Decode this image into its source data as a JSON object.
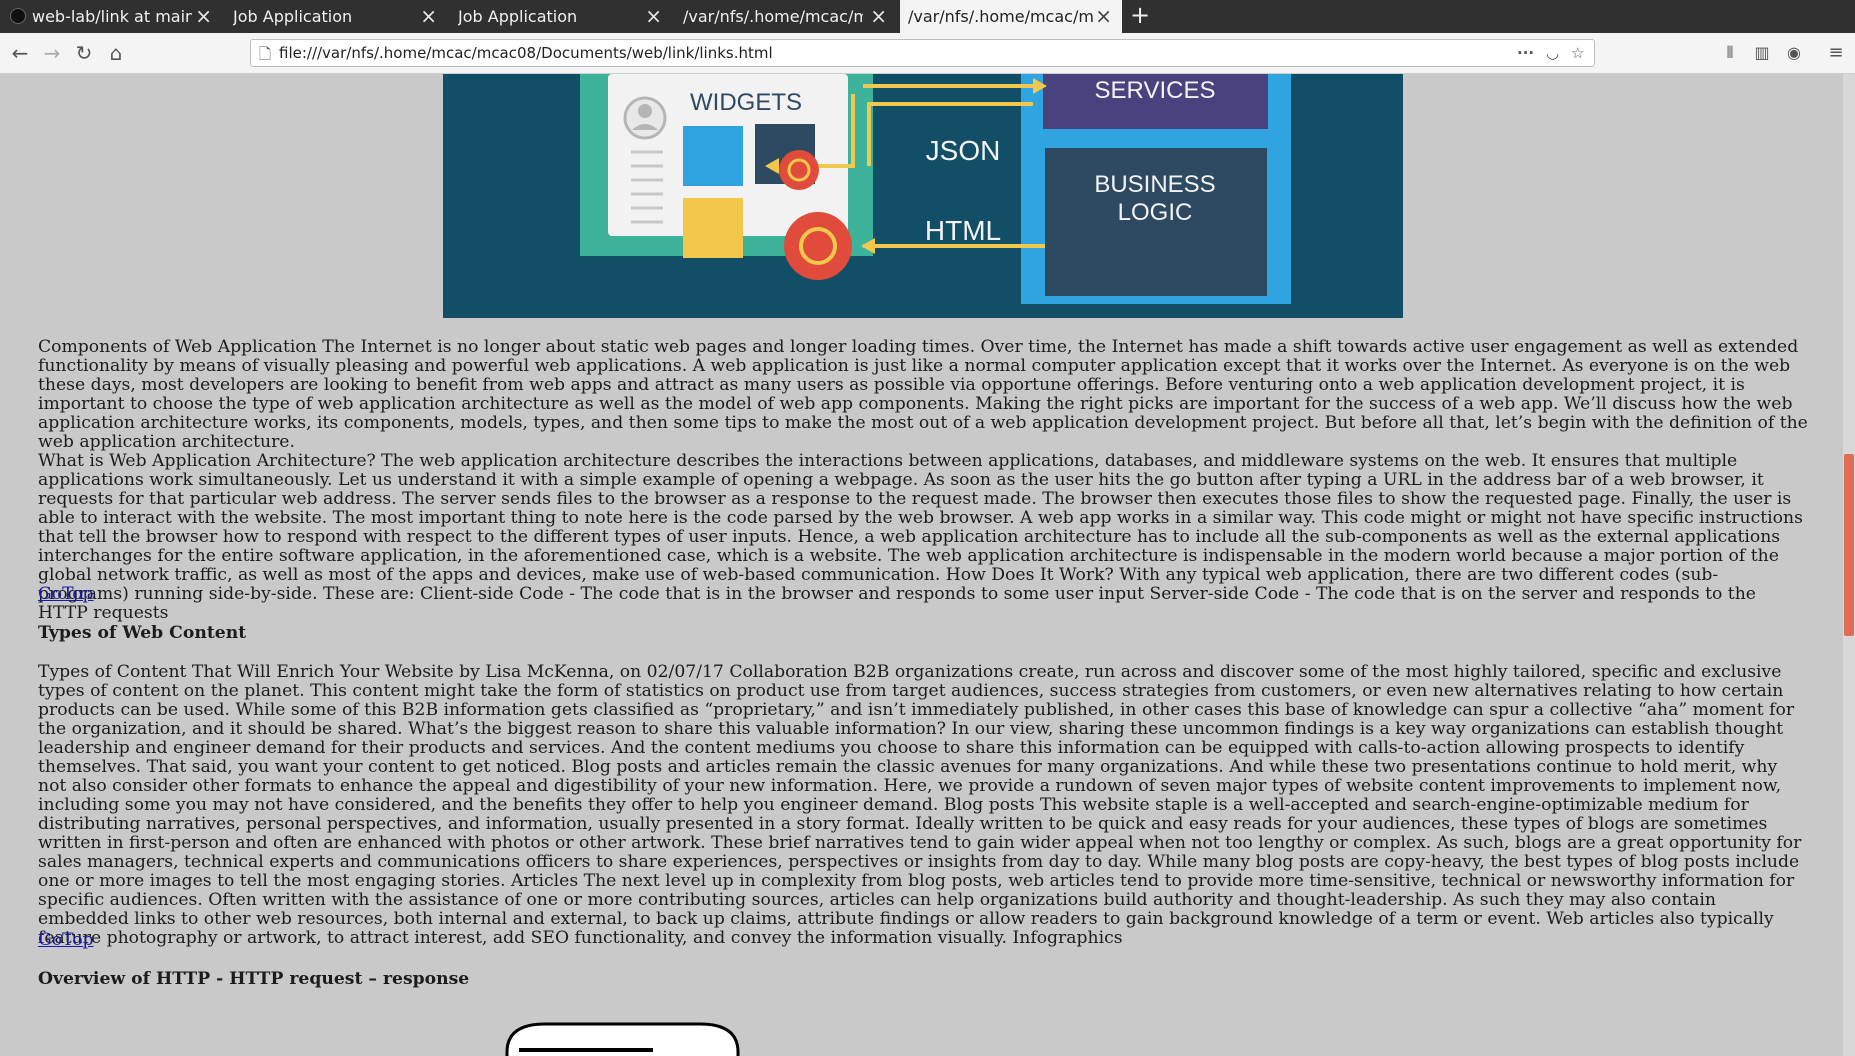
{
  "browser": {
    "tabs": [
      {
        "title": "web-lab/link at main · ac",
        "active": false
      },
      {
        "title": "Job Application",
        "active": false
      },
      {
        "title": "Job Application",
        "active": false
      },
      {
        "title": "/var/nfs/.home/mcac/mcac",
        "active": false
      },
      {
        "title": "/var/nfs/.home/mcac/mcac",
        "active": true
      }
    ],
    "url": "file:///var/nfs/.home/mcac/mcac08/Documents/web/link/links.html",
    "icons": [
      "back-icon",
      "forward-icon",
      "reload-icon",
      "home-icon",
      "page-info-icon",
      "more-icon",
      "pocket-icon",
      "bookmark-star-icon",
      "library-icon",
      "sidebar-icon",
      "account-icon",
      "menu-icon"
    ]
  },
  "hero": {
    "widgets": "WIDGETS",
    "services": "SERVICES",
    "json": "JSON",
    "html": "HTML",
    "business1": "BUSINESS",
    "business2": "LOGIC",
    "colors": {
      "bg": "#124e66",
      "teal": "#3eb39b",
      "blue": "#2fa4e0",
      "panel": "#4a417f",
      "dark": "#2e4a62",
      "yellow": "#f1c84b",
      "red": "#e14b3b"
    }
  },
  "sections": {
    "components_p1": "Components of Web Application The Internet is no longer about static web pages and longer loading times. Over time, the Internet has made a shift towards active user engagement as well as extended functionality by means of visually pleasing and powerful web applications. A web application is just like a normal computer application except that it works over the Internet. As everyone is on the web these days, most developers are looking to benefit from web apps and attract as many users as possible via opportune offerings. Before venturing onto a web application development project, it is important to choose the type of web application architecture as well as the model of web app components. Making the right picks are important for the success of a web app. We’ll discuss how the web application architecture works, its components, models, types, and then some tips to make the most out of a web application development project. But before all that, let’s begin with the definition of the web application architecture.",
    "components_p2": "What is Web Application Architecture? The web application architecture describes the interactions between applications, databases, and middleware systems on the web. It ensures that multiple applications work simultaneously. Let us understand it with a simple example of opening a webpage. As soon as the user hits the go button after typing a URL in the address bar of a web browser, it requests for that particular web address. The server sends files to the browser as a response to the request made. The browser then executes those files to show the requested page. Finally, the user is able to interact with the website. The most important thing to note here is the code parsed by the web browser. A web app works in a similar way. This code might or might not have specific instructions that tell the browser how to respond with respect to the different types of user inputs. Hence, a web application architecture has to include all the sub-components as well as the external applications interchanges for the entire software application, in the aforementioned case, which is a website. The web application architecture is indispensable in the modern world because a major portion of the global network traffic, as well as most of the apps and devices, make use of web-based communication. How Does It Work? With any typical web application, there are two different codes (sub-programs) running side-by-side. These are: Client-side Code - The code that is in the browser and responds to some user input Server-side Code - The code that is on the server and responds to the HTTP requests",
    "gotop": "GoTop",
    "types_heading": "Types of Web Content",
    "types_p": "Types of Content That Will Enrich Your Website by Lisa McKenna, on 02/07/17 Collaboration B2B organizations create, run across and discover some of the most highly tailored, specific and exclusive types of content on the planet. This content might take the form of statistics on product use from target audiences, success strategies from customers, or even new alternatives relating to how certain products can be used. While some of this B2B information gets classified as “proprietary,” and isn’t immediately published, in other cases this base of knowledge can spur a collective “aha” moment for the organization, and it should be shared. What’s the biggest reason to share this valuable information? In our view, sharing these uncommon findings is a key way organizations can establish thought leadership and engineer demand for their products and services. And the content mediums you choose to share this information can be equipped with calls-to-action allowing prospects to identify themselves. That said, you want your content to get noticed. Blog posts and articles remain the classic avenues for many organizations. And while these two presentations continue to hold merit, why not also consider other formats to enhance the appeal and digestibility of your new information. Here, we provide a rundown of seven major types of website content improvements to implement now, including some you may not have considered, and the benefits they offer to help you engineer demand. Blog posts This website staple is a well-accepted and search-engine-optimizable medium for distributing narratives, personal perspectives, and information, usually presented in a story format. Ideally written to be quick and easy reads for your audiences, these types of blogs are sometimes written in first-person and often are enhanced with photos or other artwork. These brief narratives tend to gain wider appeal when not too lengthy or complex. As such, blogs are a great opportunity for sales managers, technical experts and communications officers to share experiences, perspectives or insights from day to day. While many blog posts are copy-heavy, the best types of blog posts include one or more images to tell the most engaging stories. Articles The next level up in complexity from blog posts, web articles tend to provide more time-sensitive, technical or newsworthy information for specific audiences. Often written with the assistance of one or more contributing sources, articles can help organizations build authority and thought-leadership. As such they may also contain embedded links to other web resources, both internal and external, to back up claims, attribute findings or allow readers to gain background knowledge of a term or event. Web articles also typically feature photography or artwork, to attract interest, add SEO functionality, and convey the information visually. Infographics",
    "http_heading": "Overview of HTTP - HTTP request – response"
  }
}
